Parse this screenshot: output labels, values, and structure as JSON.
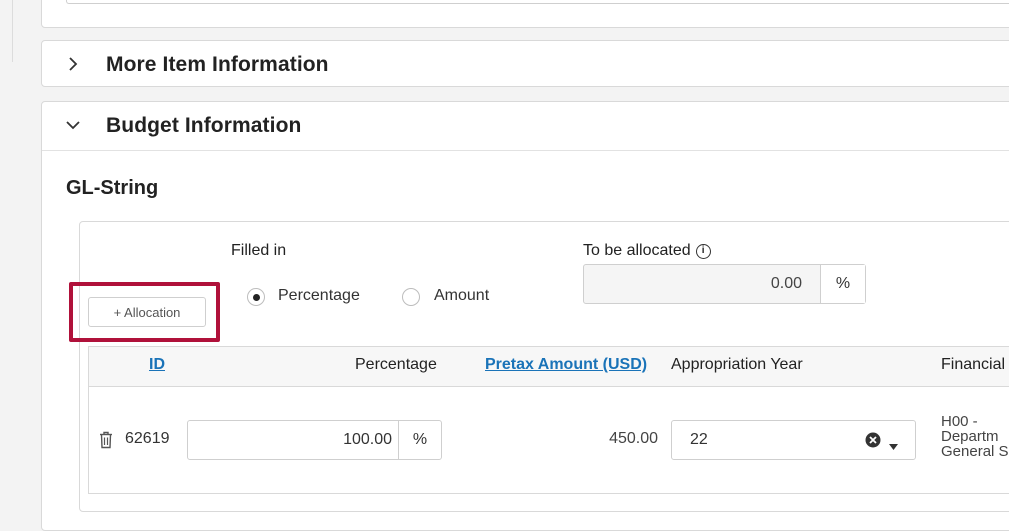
{
  "sections": {
    "more_item_information": {
      "title": "More Item Information"
    },
    "budget_information": {
      "title": "Budget Information"
    }
  },
  "gl_string": {
    "title": "GL-String",
    "filled_in_label": "Filled in",
    "radio_options": [
      {
        "label": "Percentage",
        "selected": true
      },
      {
        "label": "Amount",
        "selected": false
      }
    ],
    "to_be_allocated": {
      "label": "To be allocated",
      "value": "0.00",
      "suffix": "%"
    },
    "add_allocation_label": "+ Allocation",
    "table": {
      "headers": {
        "id": "ID",
        "percentage": "Percentage",
        "pretax_amount": "Pretax Amount (USD)",
        "appropriation_year": "Appropriation Year",
        "financial": "Financial"
      },
      "rows": [
        {
          "id": "62619",
          "percentage": "100.00",
          "percentage_suffix": "%",
          "pretax_amount": "450.00",
          "appropriation_year": "22",
          "financial_line1": "H00 -",
          "financial_line2": "Departm",
          "financial_line3": "General S"
        }
      ]
    }
  },
  "colors": {
    "highlight": "#b0113a",
    "link": "#1a73b8"
  },
  "icons": [
    "chevron-right-icon",
    "chevron-down-icon",
    "info-icon",
    "trash-icon",
    "clear-icon",
    "caret-down-icon"
  ]
}
